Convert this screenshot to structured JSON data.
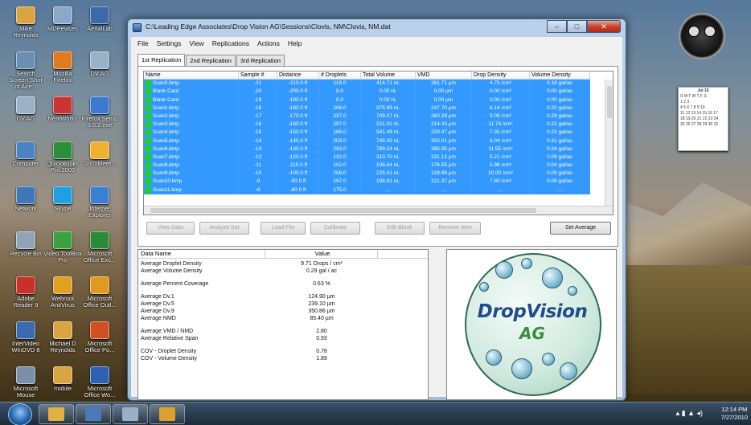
{
  "desktop": {
    "icons": [
      {
        "label": "Mike Reynolds",
        "color": "#d9a441"
      },
      {
        "label": "MDPevices",
        "color": "#8aa8c8"
      },
      {
        "label": "AerialLab",
        "color": "#3b6aa8"
      },
      {
        "label": "Search Screen Shot of Aire...",
        "color": "#6a8fb5"
      },
      {
        "label": "Mozilla Firefox",
        "color": "#e07b20"
      },
      {
        "label": "DV AG",
        "color": "#9ab2c8"
      },
      {
        "label": "DV AG",
        "color": "#9ab2c8"
      },
      {
        "label": "NeatWorks",
        "color": "#cc3333"
      },
      {
        "label": "Firefox Setup 3.6.2.exe",
        "color": "#3a7ad0"
      },
      {
        "label": "Computer",
        "color": "#4a83c1"
      },
      {
        "label": "QuickBooks Pro 2009",
        "color": "#2b8f3a"
      },
      {
        "label": "GoToMeet...",
        "color": "#f0b030"
      },
      {
        "label": "Network",
        "color": "#3f77b8"
      },
      {
        "label": "Skype",
        "color": "#20a0e0"
      },
      {
        "label": "Internet Explorer",
        "color": "#3b80d0"
      },
      {
        "label": "Recycle Bin",
        "color": "#8fa4b8"
      },
      {
        "label": "Video ToolBox Pro",
        "color": "#3ba040"
      },
      {
        "label": "Microsoft Office Exc...",
        "color": "#2b8a3a"
      },
      {
        "label": "Adobe Reader 9",
        "color": "#c8302a"
      },
      {
        "label": "Webroot AntiVirus",
        "color": "#e0a020"
      },
      {
        "label": "Microsoft Office Outl...",
        "color": "#e09a20"
      },
      {
        "label": "InterVideo WinDVD 8",
        "color": "#3a6ab0"
      },
      {
        "label": "Michael D Reynolds",
        "color": "#d9a441"
      },
      {
        "label": "Microsoft Office Po...",
        "color": "#d05020"
      },
      {
        "label": "Microsoft Mouse",
        "color": "#7a8fa8"
      },
      {
        "label": "mobile",
        "color": "#d9a441"
      },
      {
        "label": "Microsoft Office Wo...",
        "color": "#3060b0"
      }
    ],
    "calendar": {
      "month": "Jul 10",
      "days_header": "S M T W T F S",
      "rows": [
        "            1  2  3",
        "4  5  6  7  8  9 10",
        "11 12 13 14 15 16 17",
        "18 19 20 21 22 23 24",
        "25 26 27 28 29 30 31"
      ]
    }
  },
  "window": {
    "title": "C:\\Leading Edge Associates\\Drop Vision AG\\Sessions\\Clovis, NM\\Clovis, NM.dat",
    "minimize": "–",
    "maximize": "□",
    "close": "✕"
  },
  "menu": [
    "File",
    "Settings",
    "View",
    "Replications",
    "Actions",
    "Help"
  ],
  "tabs": [
    "1st Replication",
    "2nd Replication",
    "3rd Replication"
  ],
  "grid": {
    "columns": [
      "Name",
      "Sample #",
      "Distance",
      "# Droplets",
      "Total Volume",
      "VMD",
      "Drop Density",
      "Volume Density"
    ],
    "rows": [
      [
        "Scan0.bmp",
        "-21",
        "-210.0 ft",
        "118.0",
        "414.71 nL",
        "261.71 µm",
        "4.75 /cm²",
        "0.18 gal/ac"
      ],
      [
        "Blank Card",
        "-20",
        "-200.0 ft",
        "0.0",
        "0.00 nL",
        "0.00 µm",
        "0.00 /cm²",
        "0.00 gal/ac"
      ],
      [
        "Blank Card",
        "-19",
        "-190.0 ft",
        "0.0",
        "0.00 nL",
        "0.00 µm",
        "0.00 /cm²",
        "0.00 gal/ac"
      ],
      [
        "Scan1.bmp",
        "-18",
        "-180.0 ft",
        "206.0",
        "975.99 nL",
        "247.70 µm",
        "6.14 /cm²",
        "0.20 gal/ac"
      ],
      [
        "Scan2.bmp",
        "-17",
        "-170.0 ft",
        "237.0",
        "709.07 nL",
        "260.28 µm",
        "9.09 /cm²",
        "0.29 gal/ac"
      ],
      [
        "Scan3.bmp",
        "-16",
        "-160.0 ft",
        "297.0",
        "511.02 nL",
        "214.43 µm",
        "11.74 /cm²",
        "0.22 gal/ac"
      ],
      [
        "Scan4.bmp",
        "-15",
        "-150.0 ft",
        "186.0",
        "541.49 nL",
        "229.47 µm",
        "7.35 /cm²",
        "0.23 gal/ac"
      ],
      [
        "Scan5.bmp",
        "-14",
        "-140.0 ft",
        "203.0",
        "745.05 nL",
        "300.01 µm",
        "8.04 /cm²",
        "0.31 gal/ac"
      ],
      [
        "Scan6.bmp",
        "-13",
        "-130.0 ft",
        "293.0",
        "789.54 nL",
        "265.05 µm",
        "11.55 /cm²",
        "0.34 gal/ac"
      ],
      [
        "Scan7.bmp",
        "-12",
        "-120.0 ft",
        "132.0",
        "210.70 nL",
        "231.12 µm",
        "5.21 /cm²",
        "0.09 gal/ac"
      ],
      [
        "Scan8.bmp",
        "-11",
        "-110.0 ft",
        "152.0",
        "106.64 nL",
        "176.55 µm",
        "5.98 /cm²",
        "0.04 gal/ac"
      ],
      [
        "Scan9.bmp",
        "-10",
        "-100.0 ft",
        "258.0",
        "225.01 nL",
        "129.99 µm",
        "10.00 /cm²",
        "0.09 gal/ac"
      ],
      [
        "Scan10.bmp",
        "-9",
        "-90.0 ft",
        "197.0",
        "198.91 nL",
        "221.37 µm",
        "7.80 /cm²",
        "0.08 gal/ac"
      ],
      [
        "Scan11.bmp",
        "-8",
        "-80.0 ft",
        "175.0",
        "…",
        "…",
        "…",
        "…"
      ]
    ]
  },
  "buttons": {
    "view": "View Data",
    "analyze": "Analyze Set",
    "load": "Load File",
    "calibrate": "Calibrate",
    "edit": "Edit Blank",
    "remove": "Remove Item",
    "average": "Set Average"
  },
  "stats": {
    "columns": [
      "Data Name",
      "Value"
    ],
    "rows": [
      [
        "Average Droplet Density",
        "9.71 Drops / cm²"
      ],
      [
        "Average Volume Density",
        "0.29 gal / ac"
      ],
      [
        "",
        ""
      ],
      [
        "Average Percent Coverage",
        "0.63 %"
      ],
      [
        "",
        ""
      ],
      [
        "Average Dv.1",
        "124.90 µm"
      ],
      [
        "Average Dv.5",
        "239.10 µm"
      ],
      [
        "Average Dv.9",
        "350.86 µm"
      ],
      [
        "Average NMD",
        "85.40 µm"
      ],
      [
        "",
        ""
      ],
      [
        "Average VMD / NMD",
        "2.80"
      ],
      [
        "Average Relative Span",
        "0.93"
      ],
      [
        "",
        ""
      ],
      [
        "COV - Droplet Density",
        "0.78"
      ],
      [
        "COV - Volume Density",
        "1.89"
      ]
    ]
  },
  "logo": {
    "line1": "DropVision",
    "line2": "AG"
  },
  "taskbar": {
    "time": "12:14 PM",
    "date": "7/27/2010"
  }
}
